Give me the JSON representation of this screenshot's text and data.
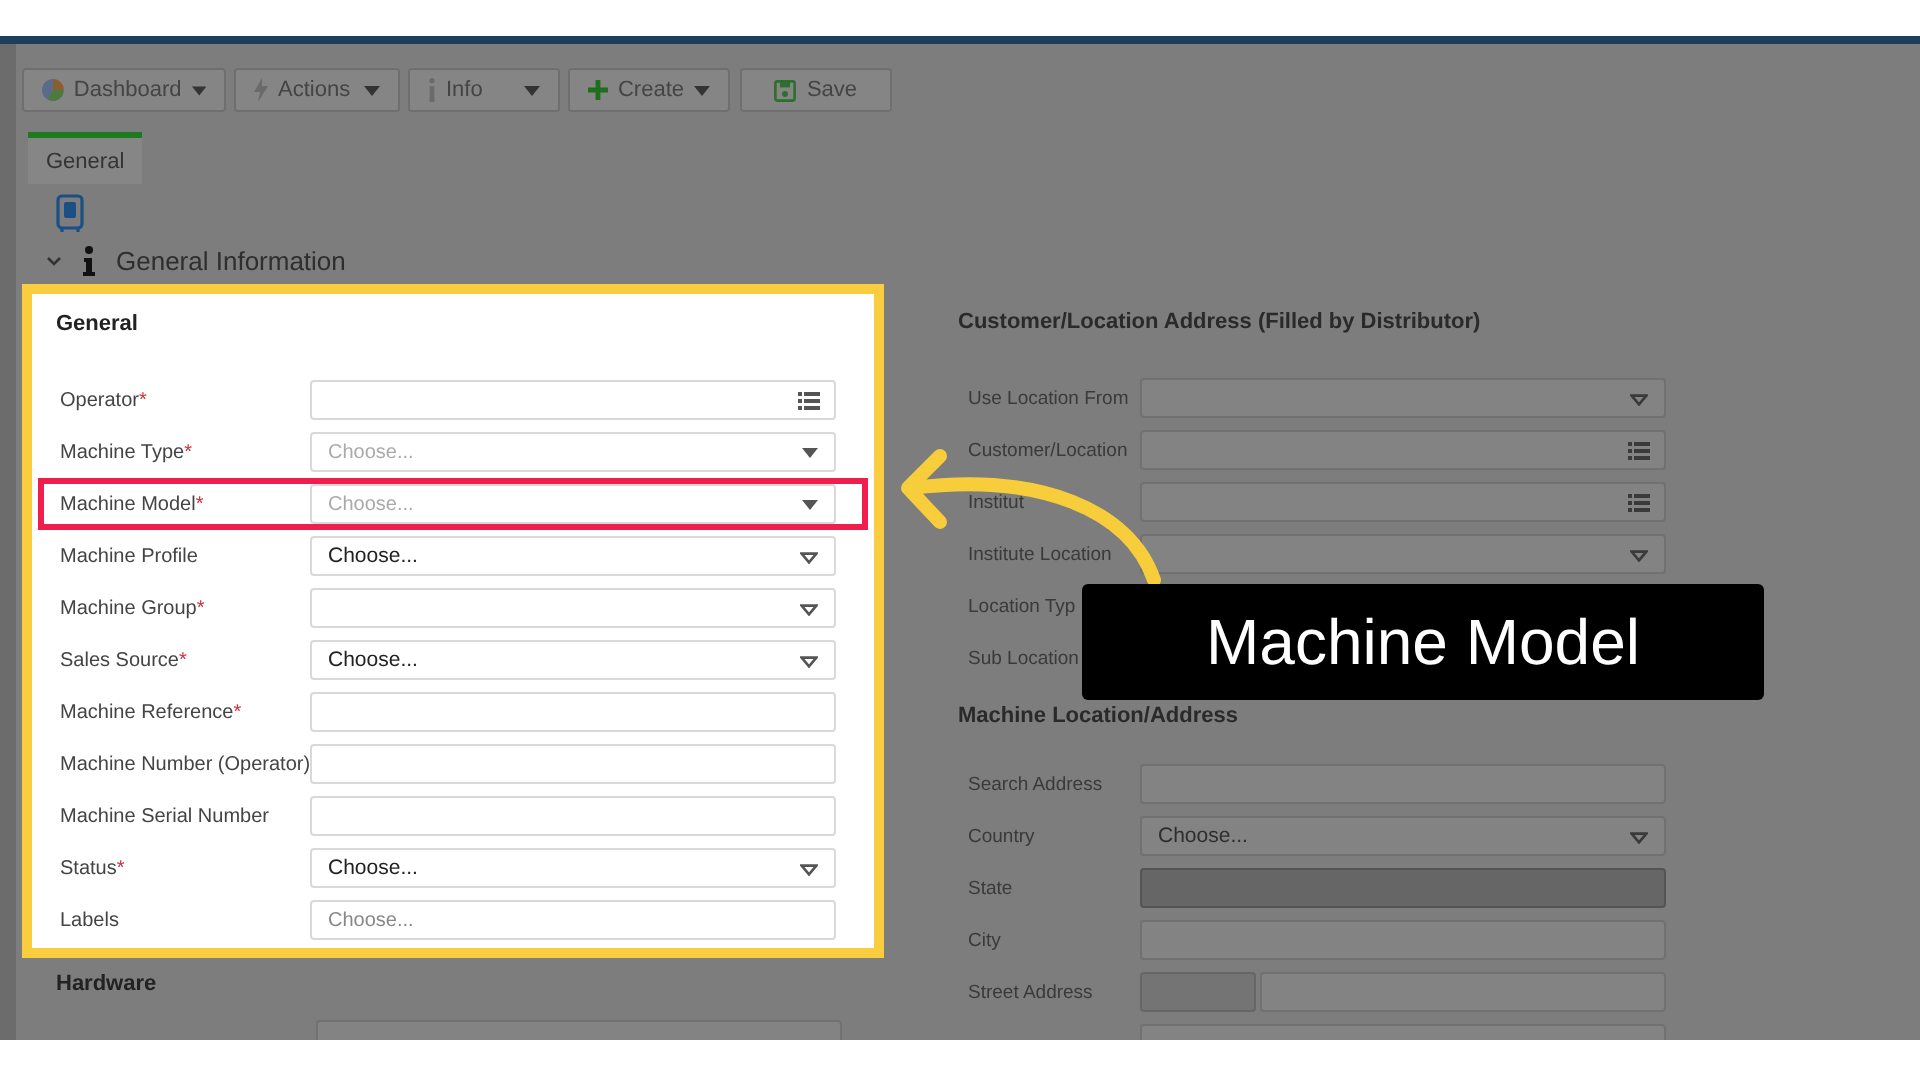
{
  "toolbar": [
    {
      "label": "Dashboard",
      "caret": true
    },
    {
      "label": "Actions",
      "caret": true
    },
    {
      "label": "Info",
      "caret": true
    },
    {
      "label": "Create",
      "caret": true
    },
    {
      "label": "Save",
      "caret": false
    }
  ],
  "tabs": [
    {
      "label": "General",
      "selected": true
    }
  ],
  "section": {
    "title": "General Information",
    "expanded": true
  },
  "general": {
    "title": "General",
    "rows": [
      {
        "label": "Operator",
        "required_mark": "*",
        "kind": "list",
        "highlighted": false
      },
      {
        "label": "Machine Type",
        "required_mark": "*",
        "kind": "select",
        "placeholder": "Choose...",
        "highlighted": false
      },
      {
        "label": "Machine Model",
        "required_mark": "*",
        "kind": "select",
        "placeholder": "Choose...",
        "highlighted": true
      },
      {
        "label": "Machine Profile",
        "kind": "dropdown",
        "value": "Choose...",
        "highlighted": false
      },
      {
        "label": "Machine Group",
        "required_mark": "*",
        "kind": "dropdown",
        "highlighted": false
      },
      {
        "label": "Sales Source",
        "required_mark": "*",
        "kind": "dropdown",
        "value": "Choose...",
        "highlighted": false
      },
      {
        "label": "Machine Reference",
        "required_mark": "*",
        "kind": "text",
        "highlighted": false
      },
      {
        "label": "Machine Number (Operator)",
        "kind": "text",
        "highlighted": false
      },
      {
        "label": "Machine Serial Number",
        "kind": "text",
        "highlighted": false
      },
      {
        "label": "Status",
        "required_mark": "*",
        "kind": "dropdown",
        "value": "Choose...",
        "highlighted": false
      },
      {
        "label": "Labels",
        "kind": "text",
        "placeholder": "Choose...",
        "highlighted": false
      }
    ]
  },
  "hardware": {
    "title": "Hardware"
  },
  "customer_address": {
    "title": "Customer/Location Address (Filled by Distributor)",
    "rows": [
      {
        "label": "Use Location From",
        "kind": "dropdown"
      },
      {
        "label": "Customer/Location",
        "kind": "list"
      },
      {
        "label": "Institut",
        "kind": "list"
      },
      {
        "label": "Institute Location",
        "kind": "dropdown"
      },
      {
        "label": "Location Typ",
        "kind": "none"
      },
      {
        "label": "Sub Location",
        "kind": "none"
      }
    ]
  },
  "machine_location": {
    "title": "Machine Location/Address",
    "rows": [
      {
        "label": "Search Address",
        "kind": "text",
        "disabled": false
      },
      {
        "label": "Country",
        "kind": "dropdown",
        "value": "Choose...",
        "disabled": false
      },
      {
        "label": "State",
        "kind": "text",
        "disabled": true
      },
      {
        "label": "City",
        "kind": "text",
        "disabled": false
      },
      {
        "label": "Street Address",
        "kind": "split",
        "disabled": false
      }
    ]
  },
  "callout": {
    "text": "Machine Model"
  }
}
